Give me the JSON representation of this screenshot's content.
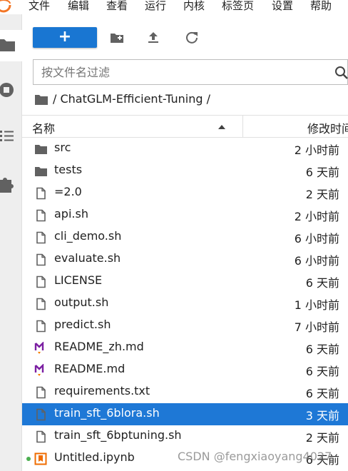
{
  "menu": {
    "items": [
      "文件",
      "编辑",
      "查看",
      "运行",
      "内核",
      "标签页",
      "设置",
      "帮助"
    ]
  },
  "toolbar": {
    "new_label": "+",
    "icons": [
      "new-folder-icon",
      "upload-icon",
      "refresh-icon"
    ]
  },
  "filter": {
    "placeholder": "按文件名过滤",
    "value": ""
  },
  "breadcrumb": {
    "path": "/ ChatGLM-Efficient-Tuning /"
  },
  "header": {
    "name": "名称",
    "modified": "修改时间"
  },
  "files": [
    {
      "name": "src",
      "modified": "2 小时前",
      "icon": "folder-icon"
    },
    {
      "name": "tests",
      "modified": "6 天前",
      "icon": "folder-icon"
    },
    {
      "name": "=2.0",
      "modified": "2 天前",
      "icon": "file-icon"
    },
    {
      "name": "api.sh",
      "modified": "2 小时前",
      "icon": "file-icon"
    },
    {
      "name": "cli_demo.sh",
      "modified": "6 小时前",
      "icon": "file-icon"
    },
    {
      "name": "evaluate.sh",
      "modified": "6 小时前",
      "icon": "file-icon"
    },
    {
      "name": "LICENSE",
      "modified": "6 天前",
      "icon": "file-icon"
    },
    {
      "name": "output.sh",
      "modified": "1 小时前",
      "icon": "file-icon"
    },
    {
      "name": "predict.sh",
      "modified": "7 小时前",
      "icon": "file-icon"
    },
    {
      "name": "README_zh.md",
      "modified": "6 天前",
      "icon": "markdown-icon"
    },
    {
      "name": "README.md",
      "modified": "6 天前",
      "icon": "markdown-icon"
    },
    {
      "name": "requirements.txt",
      "modified": "6 天前",
      "icon": "file-icon"
    },
    {
      "name": "train_sft_6blora.sh",
      "modified": "3 天前",
      "icon": "file-icon",
      "selected": true
    },
    {
      "name": "train_sft_6bptuning.sh",
      "modified": "2 天前",
      "icon": "file-icon"
    },
    {
      "name": "Untitled.ipynb",
      "modified": "6 天前",
      "icon": "notebook-icon",
      "running": true
    }
  ],
  "watermark": "CSDN @fengxiaoyang4027",
  "colors": {
    "accent": "#1976d2",
    "selected_row": "#1e78d6",
    "markdown": "#7b1fa2",
    "notebook": "#ef6c00",
    "running": "#4caf50"
  }
}
